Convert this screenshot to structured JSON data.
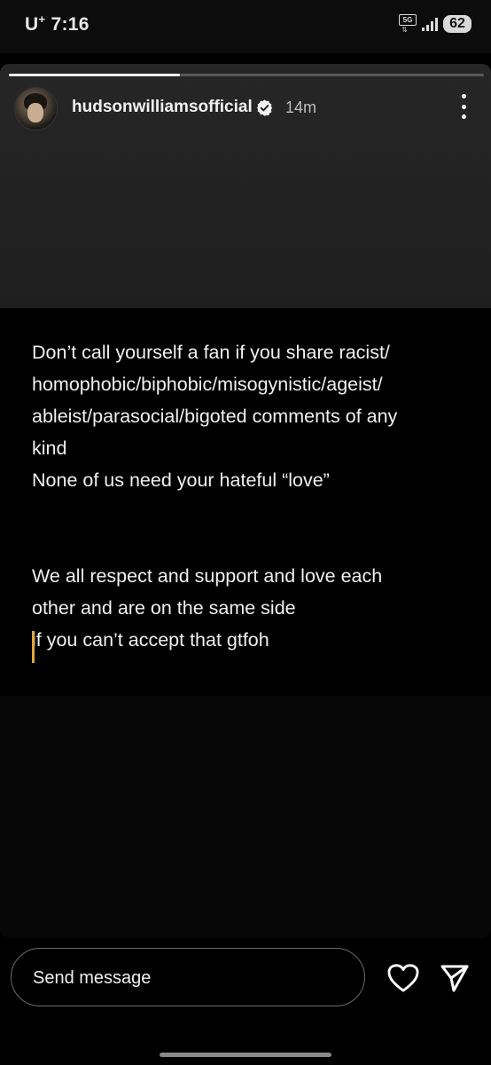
{
  "status_bar": {
    "carrier": "U",
    "carrier_sup": "+",
    "time": "7:16",
    "network": "5G",
    "battery": "62"
  },
  "story": {
    "progress": 0.36,
    "username": "hudsonwilliamsofficial",
    "verified": true,
    "timestamp": "14m",
    "paragraphs": [
      [
        "Don’t call yourself a fan if you share racist/",
        "homophobic/biphobic/misogynistic/ageist/",
        "ableist/parasocial/bigoted comments of any",
        "kind",
        "None of us need your hateful “love”"
      ],
      [
        "We all respect and support and love each",
        "other and are on the same side",
        "if you can’t accept that gtfoh"
      ]
    ]
  },
  "reply_bar": {
    "placeholder": "Send message"
  },
  "icons": {
    "verified": "verified-badge-icon",
    "more": "more-vertical-icon",
    "heart": "heart-icon",
    "send": "send-icon"
  }
}
